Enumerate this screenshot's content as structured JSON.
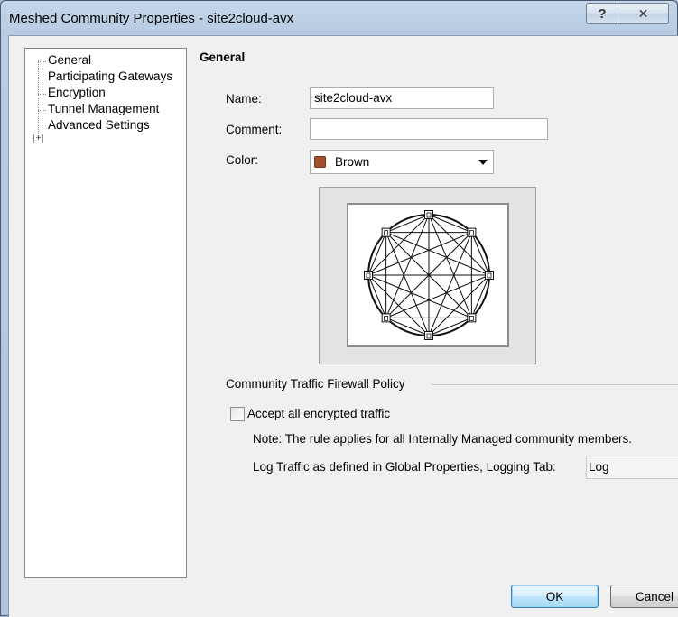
{
  "window": {
    "title": "Meshed Community Properties - site2cloud-avx"
  },
  "titlebar": {
    "help_label": "?",
    "close_label": "✕"
  },
  "tree": {
    "items": [
      {
        "label": "General",
        "selected": true
      },
      {
        "label": "Participating Gateways"
      },
      {
        "label": "Encryption"
      },
      {
        "label": "Tunnel Management"
      },
      {
        "label": "Advanced Settings",
        "expandable": true
      }
    ],
    "expander_glyph": "+"
  },
  "general": {
    "section_title": "General",
    "name_label": "Name:",
    "name_value": "site2cloud-avx",
    "comment_label": "Comment:",
    "comment_value": "",
    "color_label": "Color:",
    "color_value": "Brown",
    "color_hex": "#a0522d"
  },
  "policy": {
    "group_label": "Community Traffic Firewall Policy",
    "accept_label": "Accept all encrypted traffic",
    "accept_checked": false,
    "note": "Note: The rule applies for all Internally Managed community members.",
    "log_label": "Log Traffic as defined in Global Properties, Logging Tab:",
    "log_value": "Log"
  },
  "buttons": {
    "ok_label": "OK",
    "cancel_label": "Cancel"
  },
  "icons": {
    "mesh_preview": "meshed-topology-icon"
  }
}
